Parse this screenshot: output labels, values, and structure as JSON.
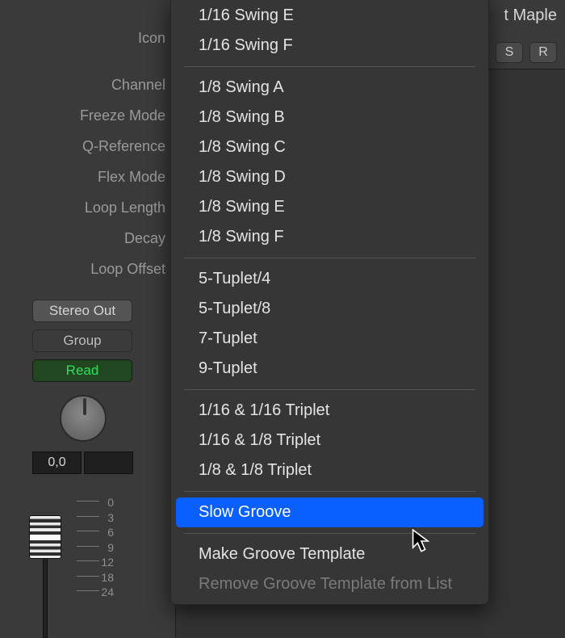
{
  "labels": {
    "icon": "Icon",
    "channel": "Channel",
    "freezeMode": "Freeze Mode",
    "qReference": "Q-Reference",
    "flexMode": "Flex Mode",
    "loopLength": "Loop Length",
    "decay": "Decay",
    "loopOffset": "Loop Offset"
  },
  "strip": {
    "output": "Stereo Out",
    "group": "Group",
    "automation": "Read",
    "pan": "0,0",
    "rulerMarks": [
      "0",
      "3",
      "6",
      "9",
      "12",
      "18",
      "24"
    ]
  },
  "header": {
    "right_label": "t Maple",
    "solo": "S",
    "record": "R"
  },
  "menu": {
    "swing16": [
      "1/16 Swing E",
      "1/16 Swing F"
    ],
    "swing8": [
      "1/8 Swing A",
      "1/8 Swing B",
      "1/8 Swing C",
      "1/8 Swing D",
      "1/8 Swing E",
      "1/8 Swing F"
    ],
    "tuplets": [
      "5-Tuplet/4",
      "5-Tuplet/8",
      "7-Tuplet",
      "9-Tuplet"
    ],
    "triplets": [
      "1/16 & 1/16 Triplet",
      "1/16 & 1/8 Triplet",
      "1/8 & 1/8 Triplet"
    ],
    "selected": "Slow Groove",
    "make": "Make Groove Template",
    "remove": "Remove Groove Template from List"
  }
}
